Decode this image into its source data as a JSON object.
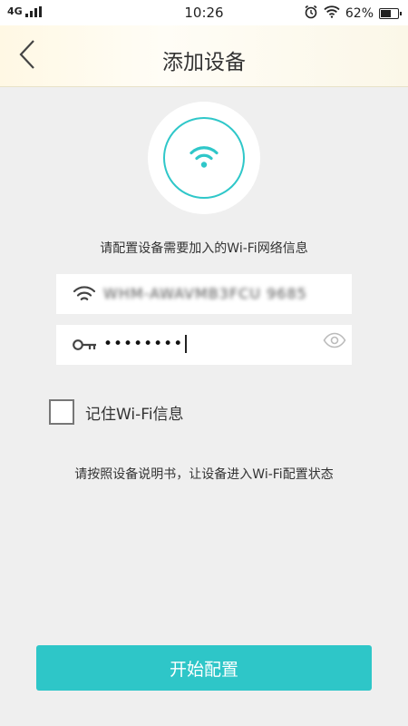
{
  "status_bar": {
    "network": "4G",
    "time": "10:26",
    "battery_percent": 62,
    "battery_label": "62%"
  },
  "header": {
    "title": "添加设备",
    "back_icon": "chevron-left-icon"
  },
  "hero": {
    "icon": "wifi-icon",
    "accent_color": "#2fc7c9"
  },
  "form": {
    "prompt": "请配置设备需要加入的Wi-Fi网络信息",
    "ssid_value": "WHM-AWAVMB3FCU 9685",
    "password_masked": "••••••••",
    "remember_label": "记住Wi-Fi信息",
    "remember_checked": false
  },
  "hint": "请按照设备说明书，让设备进入Wi-Fi配置状态",
  "action": {
    "start_label": "开始配置",
    "button_color": "#2ec6c8"
  }
}
